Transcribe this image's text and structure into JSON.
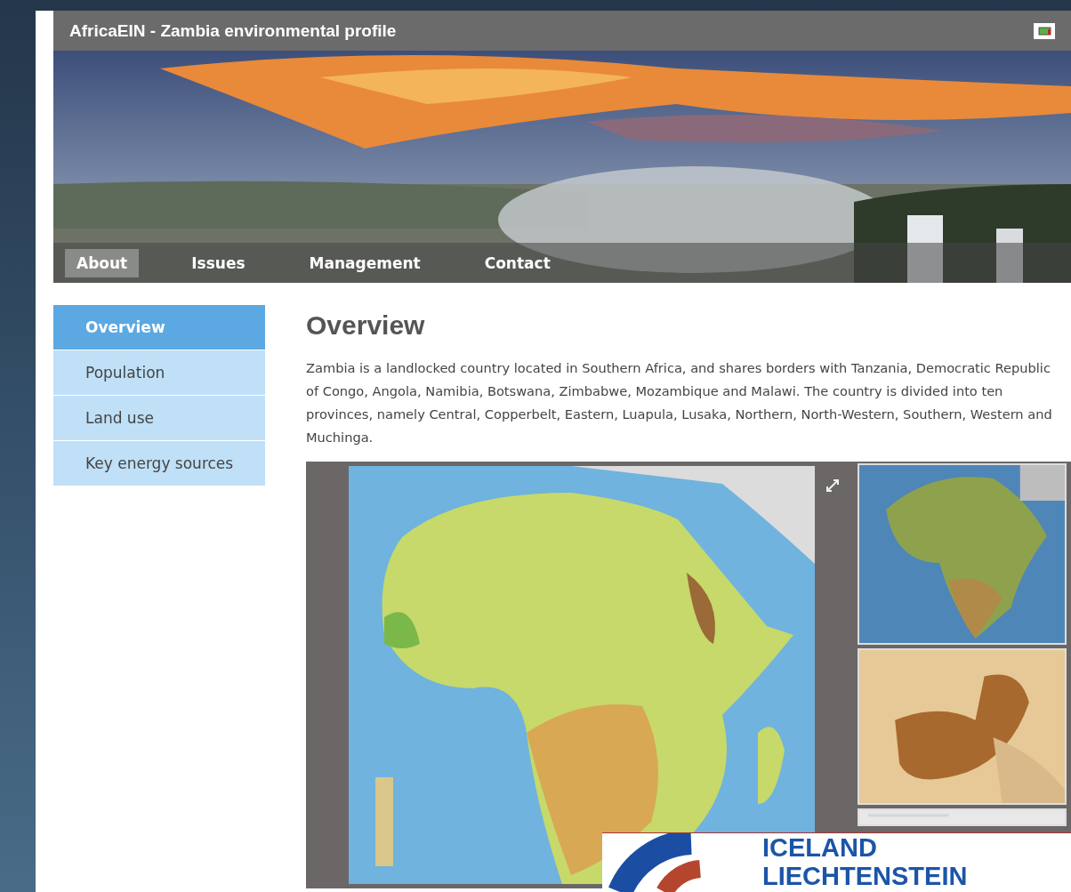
{
  "site_title": "AfricaEIN - Zambia environmental profile",
  "nav": [
    {
      "label": "About",
      "selected": true
    },
    {
      "label": "Issues",
      "selected": false
    },
    {
      "label": "Management",
      "selected": false
    },
    {
      "label": "Contact",
      "selected": false
    }
  ],
  "sidebar": {
    "items": [
      {
        "label": "Overview",
        "selected": true
      },
      {
        "label": "Population",
        "selected": false
      },
      {
        "label": "Land use",
        "selected": false
      },
      {
        "label": "Key energy sources",
        "selected": false
      }
    ]
  },
  "content": {
    "heading": "Overview",
    "paragraph": "Zambia is a landlocked country located in Southern Africa, and shares borders with Tanzania, Democratic Republic of Congo, Angola, Namibia, Botswana, Zimbabwe, Mozambique and Malawi. The country is divided into ten provinces, namely Central, Copperbelt, Eastern, Luapula, Lusaka, Northern, North-Western, Southern, Western and Muchinga."
  },
  "logo": {
    "lines": [
      "ICELAND",
      "LIECHTENSTEIN"
    ]
  }
}
